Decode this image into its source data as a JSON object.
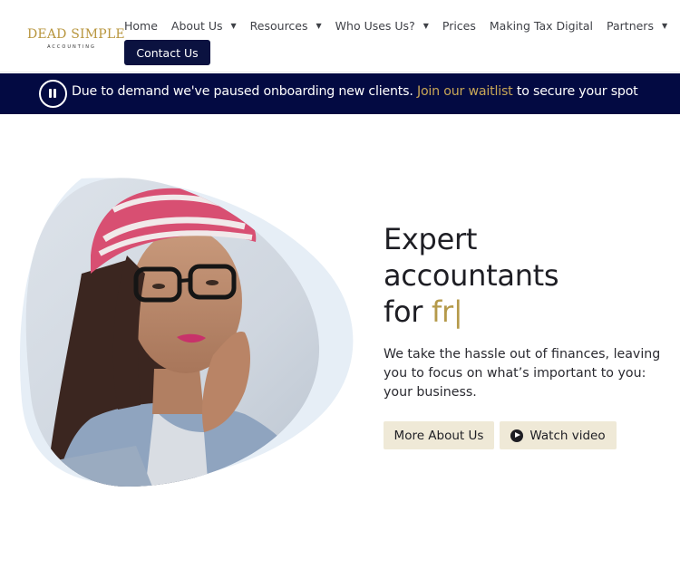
{
  "logo": {
    "main": "DEAD SIMPLE",
    "sub": "ACCOUNTING"
  },
  "nav": {
    "items": [
      {
        "label": "Home",
        "has_caret": false
      },
      {
        "label": "About Us",
        "has_caret": true
      },
      {
        "label": "Resources",
        "has_caret": true
      },
      {
        "label": "Who Uses Us?",
        "has_caret": true
      },
      {
        "label": "Prices",
        "has_caret": false
      },
      {
        "label": "Making Tax Digital",
        "has_caret": false
      },
      {
        "label": "Partners",
        "has_caret": true
      }
    ],
    "caret_glyph": "▼",
    "contact_label": "Contact Us"
  },
  "banner": {
    "text_before": "Due to demand we've paused onboarding new clients. ",
    "link_text": "Join our waitlist",
    "text_after": " to secure your spot",
    "icon": "pause-circle-icon"
  },
  "hero": {
    "title_line1": "Expert",
    "title_line2": "accountants",
    "title_line3_prefix": "for ",
    "title_typed": "fr",
    "title_cursor": "|",
    "subtitle": "We take the hassle out of finances, leaving you to focus on what’s important to you: your business.",
    "btn_more": "More About Us",
    "btn_video": "Watch video",
    "image_alt": "woman-in-pink-beanie-with-glasses"
  },
  "colors": {
    "navy": "#030a42",
    "button_navy": "#0b1240",
    "gold": "#b59a4a",
    "button_beige": "#efe9d7"
  }
}
